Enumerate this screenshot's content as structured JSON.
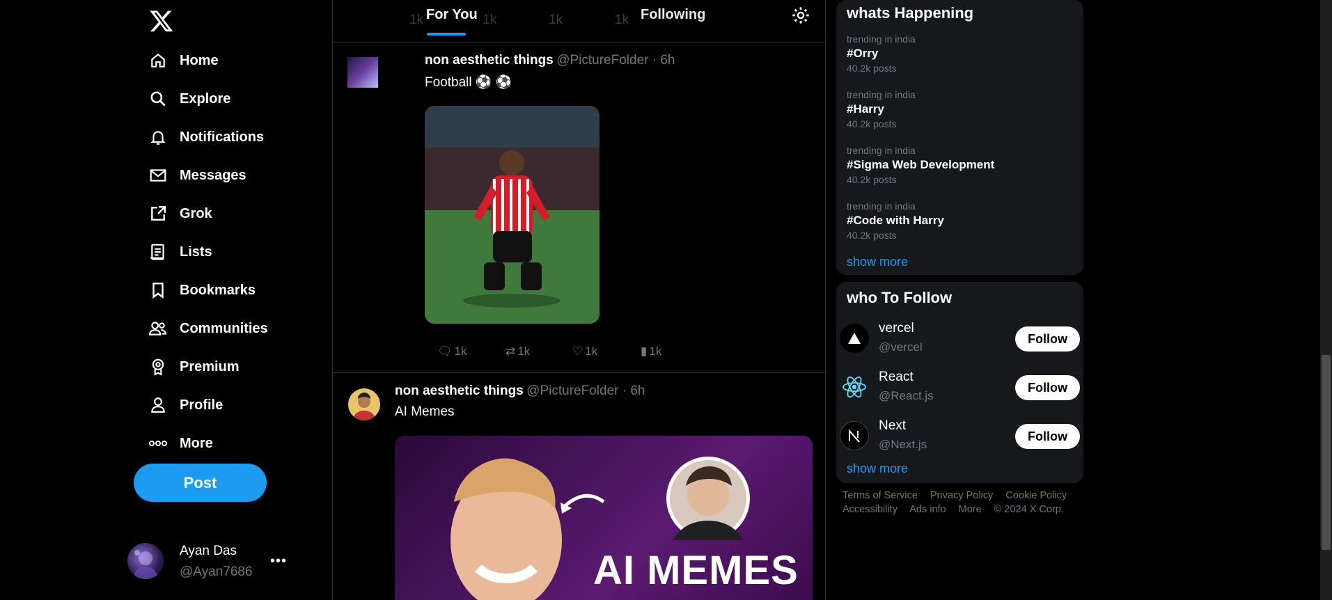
{
  "nav": {
    "items": [
      {
        "label": "Home",
        "icon": "home-icon"
      },
      {
        "label": "Explore",
        "icon": "search-icon"
      },
      {
        "label": "Notifications",
        "icon": "bell-icon"
      },
      {
        "label": "Messages",
        "icon": "mail-icon"
      },
      {
        "label": "Grok",
        "icon": "external-square-icon"
      },
      {
        "label": "Lists",
        "icon": "list-icon"
      },
      {
        "label": "Bookmarks",
        "icon": "bookmark-icon"
      },
      {
        "label": "Communities",
        "icon": "people-icon"
      },
      {
        "label": "Premium",
        "icon": "badge-icon"
      },
      {
        "label": "Profile",
        "icon": "person-icon"
      },
      {
        "label": "More",
        "icon": "more-dots-icon"
      }
    ],
    "post_label": "Post"
  },
  "me": {
    "name": "Ayan Das",
    "handle": "@Ayan7686",
    "more": "•••"
  },
  "tabs": {
    "for_you": "For You",
    "following": "Following"
  },
  "ghost_counts": [
    "1k",
    "1k",
    "1k",
    "1k"
  ],
  "tweets": [
    {
      "name": "non aesthetic things",
      "meta": "@PictureFolder · 6h",
      "text": "Football ⚽ ⚽",
      "image_alt": "football player celebrating",
      "counts": {
        "replies": "1k",
        "retweets": "1k",
        "likes": "1k",
        "views": "1k"
      }
    },
    {
      "name": "non aesthetic things",
      "meta": "@PictureFolder · 6h",
      "text": "AI Memes",
      "image_caption": "AI MEMES"
    }
  ],
  "trending": {
    "title": "whats Happening",
    "items": [
      {
        "category": "trending in india",
        "tag": "#Orry",
        "count": "40.2k posts"
      },
      {
        "category": "trending in india",
        "tag": "#Harry",
        "count": "40.2k posts"
      },
      {
        "category": "trending in india",
        "tag": "#Sigma Web Development",
        "count": "40.2k posts"
      },
      {
        "category": "trending in india",
        "tag": "#Code with Harry",
        "count": "40.2k posts"
      }
    ],
    "show_more": "show more"
  },
  "who_to_follow": {
    "title": "who To Follow",
    "items": [
      {
        "name": "vercel",
        "handle": "@vercel",
        "button": "Follow",
        "icon": "vercel-triangle-icon"
      },
      {
        "name": "React",
        "handle": "@React.js",
        "button": "Follow",
        "icon": "react-atom-icon"
      },
      {
        "name": "Next",
        "handle": "@Next.js",
        "button": "Follow",
        "icon": "next-n-icon"
      }
    ],
    "show_more": "show more"
  },
  "footer": {
    "row1": [
      "Terms of Service",
      "Privacy Policy",
      "Cookie Policy"
    ],
    "row2": [
      "Accessibility",
      "Ads info",
      "More",
      "© 2024 X Corp."
    ]
  },
  "colors": {
    "accent": "#1d9bf0",
    "background": "#000000",
    "card": "#16181c",
    "muted": "#71767b"
  }
}
